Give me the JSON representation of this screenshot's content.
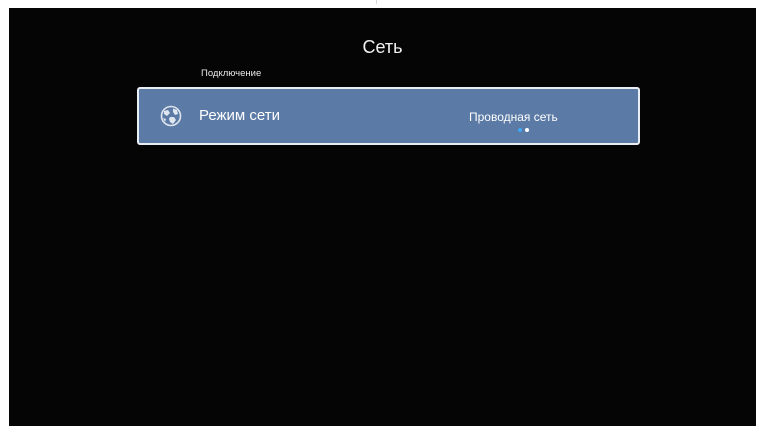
{
  "header": {
    "title": "Сеть"
  },
  "section": {
    "label": "Подключение"
  },
  "network_mode": {
    "label": "Режим сети",
    "value": "Проводная сеть",
    "icon": "globe-network-icon",
    "options_count": 2,
    "selected_index": 0
  },
  "colors": {
    "background": "#050505",
    "row_highlight": "#5b7aa5",
    "row_border": "#e9eef5",
    "dot_active": "#3fa9f5",
    "dot_inactive": "#ffffff"
  }
}
